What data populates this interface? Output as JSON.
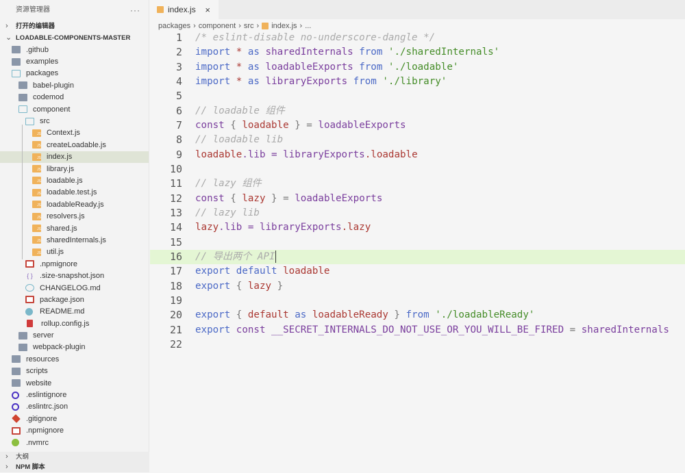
{
  "sidebar": {
    "title": "资源管理器",
    "more": "···",
    "open_editors": "打开的编辑器",
    "root": "LOADABLE-COMPONENTS-MASTER",
    "items": [
      {
        "label": ".github",
        "depth": 0,
        "icon": "folder"
      },
      {
        "label": "examples",
        "depth": 0,
        "icon": "folder"
      },
      {
        "label": "packages",
        "depth": 0,
        "icon": "folder-open"
      },
      {
        "label": "babel-plugin",
        "depth": 1,
        "icon": "folder"
      },
      {
        "label": "codemod",
        "depth": 1,
        "icon": "folder"
      },
      {
        "label": "component",
        "depth": 1,
        "icon": "folder-open"
      },
      {
        "label": "src",
        "depth": 2,
        "icon": "folder-open"
      },
      {
        "label": "Context.js",
        "depth": 3,
        "icon": "js"
      },
      {
        "label": "createLoadable.js",
        "depth": 3,
        "icon": "js"
      },
      {
        "label": "index.js",
        "depth": 3,
        "icon": "js",
        "selected": true
      },
      {
        "label": "library.js",
        "depth": 3,
        "icon": "js"
      },
      {
        "label": "loadable.js",
        "depth": 3,
        "icon": "js"
      },
      {
        "label": "loadable.test.js",
        "depth": 3,
        "icon": "js"
      },
      {
        "label": "loadableReady.js",
        "depth": 3,
        "icon": "js"
      },
      {
        "label": "resolvers.js",
        "depth": 3,
        "icon": "js"
      },
      {
        "label": "shared.js",
        "depth": 3,
        "icon": "js"
      },
      {
        "label": "sharedInternals.js",
        "depth": 3,
        "icon": "js"
      },
      {
        "label": "util.js",
        "depth": 3,
        "icon": "js"
      },
      {
        "label": ".npmignore",
        "depth": 2,
        "icon": "npm"
      },
      {
        "label": ".size-snapshot.json",
        "depth": 2,
        "icon": "json"
      },
      {
        "label": "CHANGELOG.md",
        "depth": 2,
        "icon": "changelog"
      },
      {
        "label": "package.json",
        "depth": 2,
        "icon": "npm"
      },
      {
        "label": "README.md",
        "depth": 2,
        "icon": "readme"
      },
      {
        "label": "rollup.config.js",
        "depth": 2,
        "icon": "rollup"
      },
      {
        "label": "server",
        "depth": 1,
        "icon": "folder"
      },
      {
        "label": "webpack-plugin",
        "depth": 1,
        "icon": "folder"
      },
      {
        "label": "resources",
        "depth": 0,
        "icon": "folder"
      },
      {
        "label": "scripts",
        "depth": 0,
        "icon": "folder"
      },
      {
        "label": "website",
        "depth": 0,
        "icon": "folder"
      },
      {
        "label": ".eslintignore",
        "depth": 0,
        "icon": "eslint"
      },
      {
        "label": ".eslintrc.json",
        "depth": 0,
        "icon": "eslint"
      },
      {
        "label": ".gitignore",
        "depth": 0,
        "icon": "git"
      },
      {
        "label": ".npmignore",
        "depth": 0,
        "icon": "npm"
      },
      {
        "label": ".nvmrc",
        "depth": 0,
        "icon": "nvm"
      }
    ],
    "outline": "大纲",
    "npm_scripts": "NPM 脚本"
  },
  "tab": {
    "label": "index.js",
    "close": "×",
    "icon": "js-file-icon"
  },
  "breadcrumb": [
    "packages",
    "component",
    "src",
    "index.js",
    "..."
  ],
  "current_line": 16,
  "code": [
    [
      [
        "/* eslint-disable no-underscore-dangle */",
        "cm"
      ]
    ],
    [
      [
        "import",
        "kw"
      ],
      [
        " ",
        "pl"
      ],
      [
        "*",
        "var"
      ],
      [
        " ",
        "pl"
      ],
      [
        "as",
        "kw"
      ],
      [
        " sharedInternals ",
        "st"
      ],
      [
        "from",
        "kw"
      ],
      [
        " './sharedInternals'",
        "str"
      ]
    ],
    [
      [
        "import",
        "kw"
      ],
      [
        " ",
        "pl"
      ],
      [
        "*",
        "var"
      ],
      [
        " ",
        "pl"
      ],
      [
        "as",
        "kw"
      ],
      [
        " loadableExports ",
        "st"
      ],
      [
        "from",
        "kw"
      ],
      [
        " './loadable'",
        "str"
      ]
    ],
    [
      [
        "import",
        "kw"
      ],
      [
        " ",
        "pl"
      ],
      [
        "*",
        "var"
      ],
      [
        " ",
        "pl"
      ],
      [
        "as",
        "kw"
      ],
      [
        " libraryExports ",
        "st"
      ],
      [
        "from",
        "kw"
      ],
      [
        " './library'",
        "str"
      ]
    ],
    [],
    [
      [
        "// loadable 组件",
        "cm"
      ]
    ],
    [
      [
        "const",
        "st"
      ],
      [
        " { ",
        "op"
      ],
      [
        "loadable",
        "var"
      ],
      [
        " } = ",
        "op"
      ],
      [
        "loadableExports",
        "st"
      ]
    ],
    [
      [
        "// loadable lib",
        "cm"
      ]
    ],
    [
      [
        "loadable",
        "var"
      ],
      [
        ".lib = ",
        "st"
      ],
      [
        "libraryExports",
        "st"
      ],
      [
        ".loadable",
        "var"
      ]
    ],
    [],
    [
      [
        "// lazy 组件",
        "cm"
      ]
    ],
    [
      [
        "const",
        "st"
      ],
      [
        " { ",
        "op"
      ],
      [
        "lazy",
        "var"
      ],
      [
        " } = ",
        "op"
      ],
      [
        "loadableExports",
        "st"
      ]
    ],
    [
      [
        "// lazy lib",
        "cm"
      ]
    ],
    [
      [
        "lazy",
        "var"
      ],
      [
        ".lib = ",
        "st"
      ],
      [
        "libraryExports",
        "st"
      ],
      [
        ".lazy",
        "var"
      ]
    ],
    [],
    [
      [
        "// 导出两个 API",
        "cm"
      ]
    ],
    [
      [
        "export",
        "kw"
      ],
      [
        " default ",
        "kw"
      ],
      [
        "loadable",
        "var"
      ]
    ],
    [
      [
        "export",
        "kw"
      ],
      [
        " { ",
        "op"
      ],
      [
        "lazy",
        "var"
      ],
      [
        " }",
        "op"
      ]
    ],
    [],
    [
      [
        "export",
        "kw"
      ],
      [
        " { ",
        "op"
      ],
      [
        "default",
        "var"
      ],
      [
        " as ",
        "kw"
      ],
      [
        "loadableReady",
        "var"
      ],
      [
        " } ",
        "op"
      ],
      [
        "from",
        "kw"
      ],
      [
        " './loadableReady'",
        "str"
      ]
    ],
    [
      [
        "export",
        "kw"
      ],
      [
        " const ",
        "st"
      ],
      [
        "__SECRET_INTERNALS_DO_NOT_USE_OR_YOU_WILL_BE_FIRED",
        "st"
      ],
      [
        " = ",
        "op"
      ],
      [
        "sharedInternals",
        "st"
      ]
    ],
    []
  ]
}
